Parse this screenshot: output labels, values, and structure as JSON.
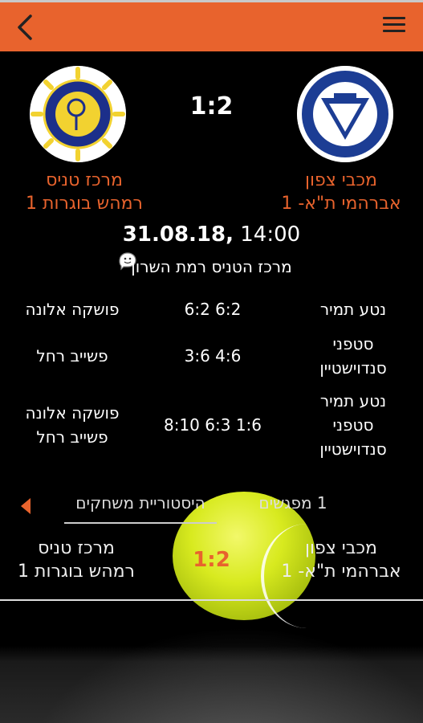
{
  "header": {
    "back_icon": "chevron-left-icon",
    "menu_icon": "hamburger-menu-icon",
    "color": "#e8632d"
  },
  "match": {
    "score": "1:2",
    "home_team": [
      "מכבי צפון",
      "אברהמי ת\"א- 1"
    ],
    "away_team": [
      "מרכז טניס",
      "רמהש בוגרות 1"
    ],
    "date": "31.08.18,",
    "time": "14:00",
    "venue": "מרכז הטניס רמת השרון",
    "navigation_icon": "waze-icon"
  },
  "games": [
    {
      "home": [
        "נטע תמיר"
      ],
      "score": "6:2 6:2",
      "away": [
        "פושקה אלונה"
      ]
    },
    {
      "home": [
        "סטפני",
        "סנדוישטיין"
      ],
      "score": "4:6 3:6",
      "away": [
        "פשייב רחל"
      ]
    },
    {
      "home": [
        "נטע תמיר",
        "סטפני",
        "סנדוישטיין"
      ],
      "score": "1:6 6:3 8:10",
      "away": [
        "פושקה אלונה",
        "פשייב רחל"
      ]
    }
  ],
  "tabs": {
    "history": "היסטוריית משחקים",
    "meetings": "1 מפגשים"
  },
  "head_to_head": {
    "home_team": [
      "מכבי צפון",
      "אברהמי ת\"א- 1"
    ],
    "away_team": [
      "מרכז טניס",
      "רמהש בוגרות 1"
    ],
    "score": "1:2"
  }
}
